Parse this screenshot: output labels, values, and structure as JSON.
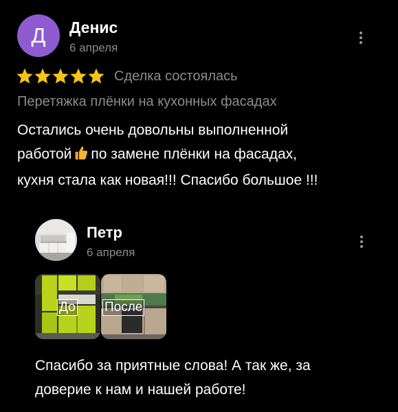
{
  "review": {
    "avatar_letter": "Д",
    "avatar_color": "#8e5bd1",
    "author": "Денис",
    "date": "6 апреля",
    "rating": 5,
    "rating_max": 5,
    "deal_status": "Сделка состоялась",
    "service": "Перетяжка плёнки на кухонных фасадах",
    "text_line1": "Остались очень довольны выполненной",
    "text_line2_before": "работой",
    "text_line2_emoji": "thumbs-up-emoji",
    "text_line2_after": "по замене плёнки на фасадах,",
    "text_line3": "кухня стала как новая!!! Спасибо большое !!!",
    "menu_icon": "more-vertical-icon"
  },
  "reply": {
    "author": "Петр",
    "date": "6 апреля",
    "avatar_image": "kitchen-photo-avatar",
    "photos": [
      {
        "label": "До",
        "image": "kitchen-before-photo"
      },
      {
        "label": "После",
        "image": "kitchen-after-photo"
      }
    ],
    "text_line1": "Спасибо за приятные слова! А так же, за",
    "text_line2": "доверие к нам и нашей работе!",
    "menu_icon": "more-vertical-icon"
  },
  "colors": {
    "background": "#000000",
    "star": "#f5c518",
    "muted_text": "#8c8c8c"
  }
}
